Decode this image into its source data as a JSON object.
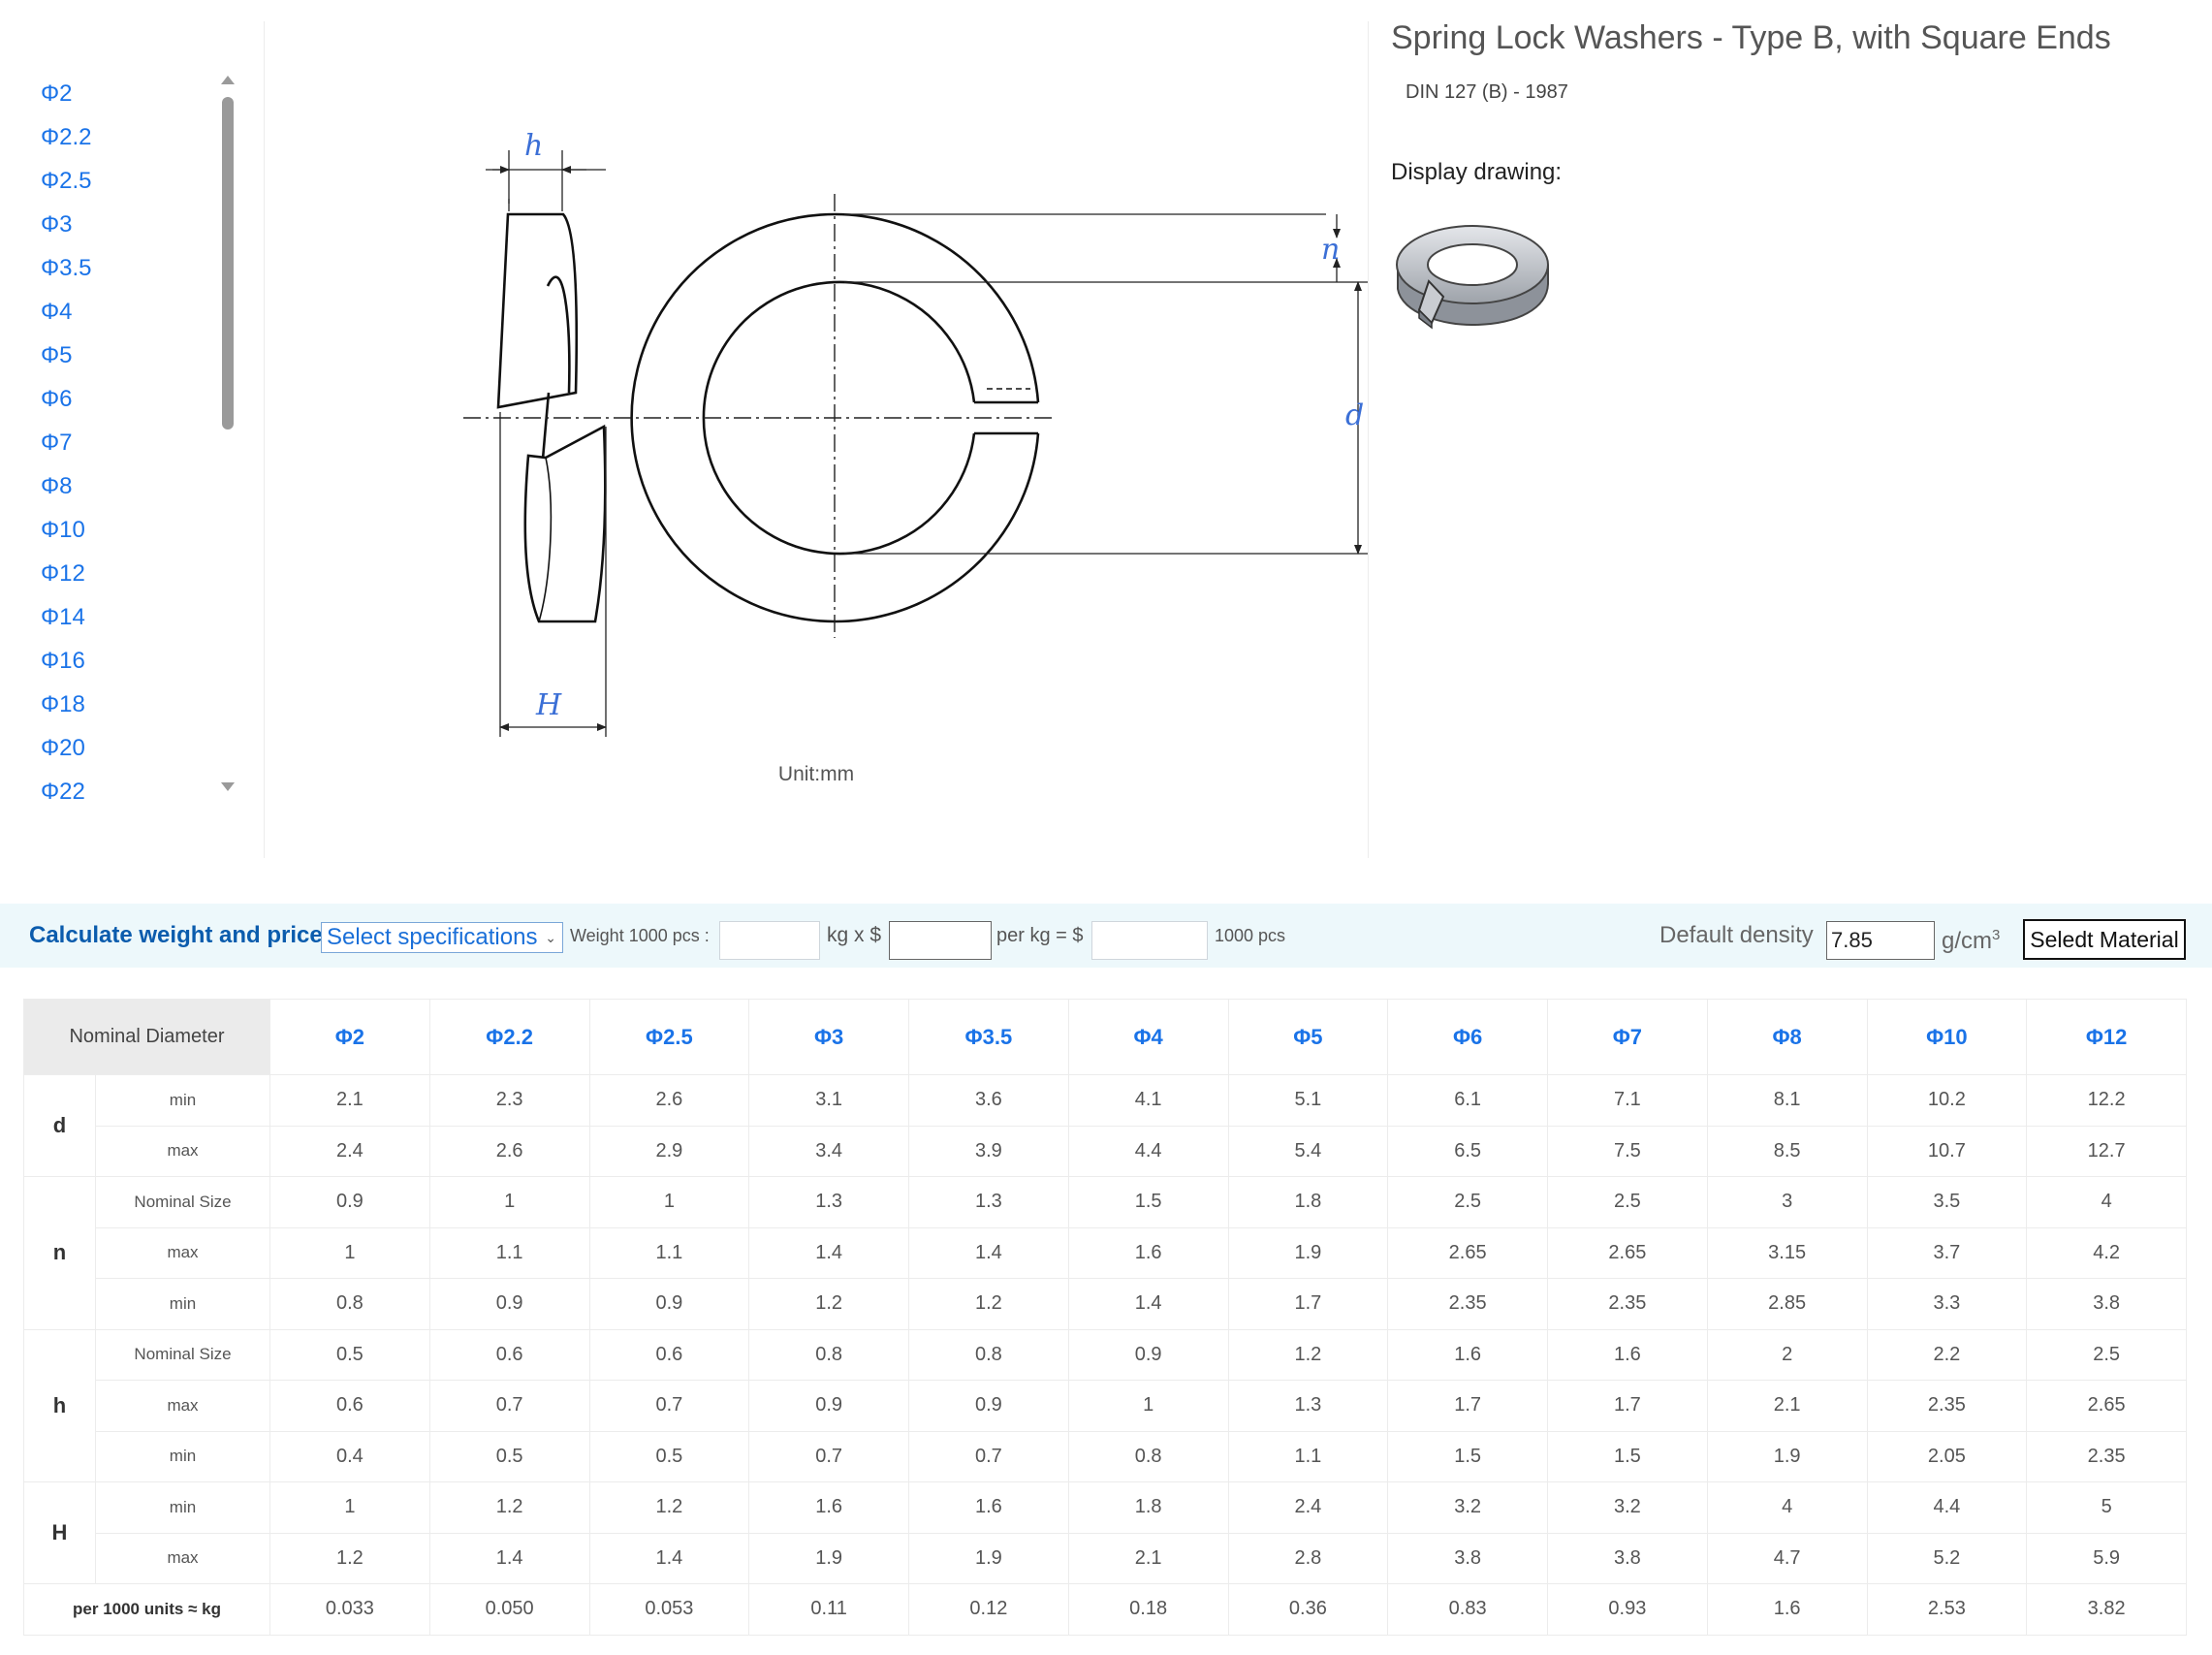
{
  "sizes": [
    "Φ2",
    "Φ2.2",
    "Φ2.5",
    "Φ3",
    "Φ3.5",
    "Φ4",
    "Φ5",
    "Φ6",
    "Φ7",
    "Φ8",
    "Φ10",
    "Φ12",
    "Φ14",
    "Φ16",
    "Φ18",
    "Φ20",
    "Φ22"
  ],
  "drawing": {
    "label_h_thickness": "h",
    "label_n": "n",
    "label_d": "d",
    "label_H_height": "H",
    "unit": "Unit:mm"
  },
  "product": {
    "title": "Spring Lock Washers - Type B, with Square Ends",
    "standard": "DIN 127 (B) - 1987",
    "display_label": "Display drawing:"
  },
  "calculator": {
    "title": "Calculate weight and price.",
    "select_label": "Select specifications",
    "weight_label": "Weight 1000 pcs :",
    "weight_value": "",
    "kg_label": "kg x $",
    "price_value": "",
    "per_kg_label": "per kg = $",
    "total_value": "",
    "pcs_label": "1000 pcs",
    "density_label": "Default density",
    "density_value": "7.85",
    "density_unit": "g/cm",
    "density_exp": "3",
    "material_button": "Seledt Material"
  },
  "table": {
    "corner_label": "Nominal Diameter",
    "columns": [
      "Φ2",
      "Φ2.2",
      "Φ2.5",
      "Φ3",
      "Φ3.5",
      "Φ4",
      "Φ5",
      "Φ6",
      "Φ7",
      "Φ8",
      "Φ10",
      "Φ12"
    ],
    "groups": [
      {
        "name": "d",
        "rows": [
          {
            "label": "min",
            "values": [
              "2.1",
              "2.3",
              "2.6",
              "3.1",
              "3.6",
              "4.1",
              "5.1",
              "6.1",
              "7.1",
              "8.1",
              "10.2",
              "12.2"
            ]
          },
          {
            "label": "max",
            "values": [
              "2.4",
              "2.6",
              "2.9",
              "3.4",
              "3.9",
              "4.4",
              "5.4",
              "6.5",
              "7.5",
              "8.5",
              "10.7",
              "12.7"
            ]
          }
        ]
      },
      {
        "name": "n",
        "rows": [
          {
            "label": "Nominal Size",
            "values": [
              "0.9",
              "1",
              "1",
              "1.3",
              "1.3",
              "1.5",
              "1.8",
              "2.5",
              "2.5",
              "3",
              "3.5",
              "4"
            ]
          },
          {
            "label": "max",
            "values": [
              "1",
              "1.1",
              "1.1",
              "1.4",
              "1.4",
              "1.6",
              "1.9",
              "2.65",
              "2.65",
              "3.15",
              "3.7",
              "4.2"
            ]
          },
          {
            "label": "min",
            "values": [
              "0.8",
              "0.9",
              "0.9",
              "1.2",
              "1.2",
              "1.4",
              "1.7",
              "2.35",
              "2.35",
              "2.85",
              "3.3",
              "3.8"
            ]
          }
        ]
      },
      {
        "name": "h",
        "rows": [
          {
            "label": "Nominal Size",
            "values": [
              "0.5",
              "0.6",
              "0.6",
              "0.8",
              "0.8",
              "0.9",
              "1.2",
              "1.6",
              "1.6",
              "2",
              "2.2",
              "2.5"
            ]
          },
          {
            "label": "max",
            "values": [
              "0.6",
              "0.7",
              "0.7",
              "0.9",
              "0.9",
              "1",
              "1.3",
              "1.7",
              "1.7",
              "2.1",
              "2.35",
              "2.65"
            ]
          },
          {
            "label": "min",
            "values": [
              "0.4",
              "0.5",
              "0.5",
              "0.7",
              "0.7",
              "0.8",
              "1.1",
              "1.5",
              "1.5",
              "1.9",
              "2.05",
              "2.35"
            ]
          }
        ]
      },
      {
        "name": "H",
        "rows": [
          {
            "label": "min",
            "values": [
              "1",
              "1.2",
              "1.2",
              "1.6",
              "1.6",
              "1.8",
              "2.4",
              "3.2",
              "3.2",
              "4",
              "4.4",
              "5"
            ]
          },
          {
            "label": "max",
            "values": [
              "1.2",
              "1.4",
              "1.4",
              "1.9",
              "1.9",
              "2.1",
              "2.8",
              "3.8",
              "3.8",
              "4.7",
              "5.2",
              "5.9"
            ]
          }
        ]
      }
    ],
    "weight_row": {
      "label": "per 1000 units ≈ kg",
      "values": [
        "0.033",
        "0.050",
        "0.053",
        "0.11",
        "0.12",
        "0.18",
        "0.36",
        "0.83",
        "0.93",
        "1.6",
        "2.53",
        "3.82"
      ]
    }
  }
}
